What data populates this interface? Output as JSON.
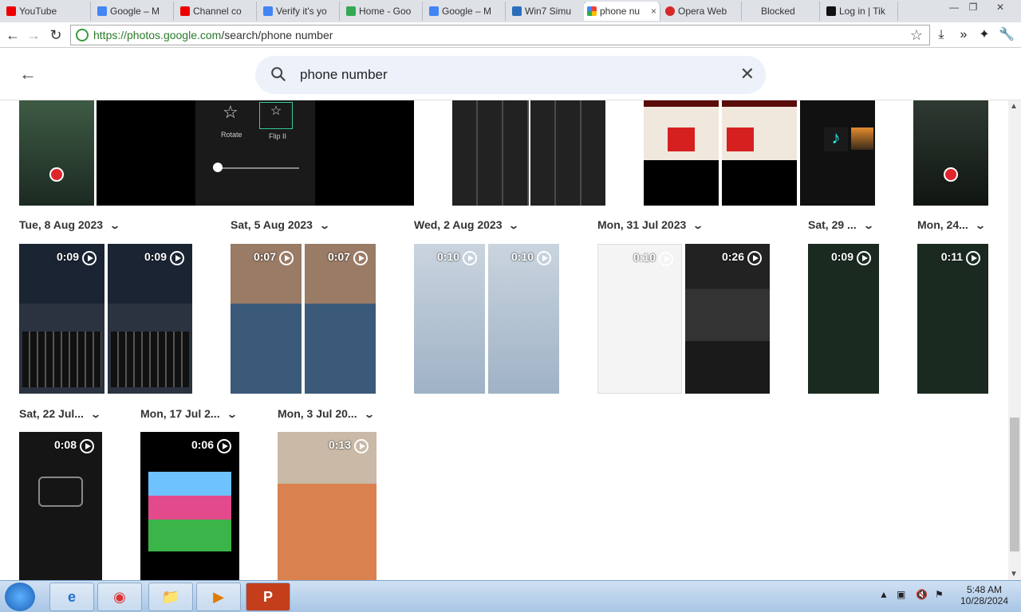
{
  "browser": {
    "tabs": [
      {
        "label": "YouTube",
        "color": "#e00"
      },
      {
        "label": "Google – M",
        "color": "#4285f4"
      },
      {
        "label": "Channel co",
        "color": "#e00"
      },
      {
        "label": "Verify it's yo",
        "color": "#4285f4"
      },
      {
        "label": "Home - Goo",
        "color": "#34a853"
      },
      {
        "label": "Google – M",
        "color": "#4285f4"
      },
      {
        "label": "Win7 Simu",
        "color": "#2a6ebb"
      },
      {
        "label": "phone nu",
        "color": "#fbbc05"
      },
      {
        "label": "Opera Web",
        "color": "#d62828"
      },
      {
        "label": "Blocked",
        "color": "#999"
      },
      {
        "label": "Log in | Tik",
        "color": "#111"
      }
    ],
    "active_tab_close": "×",
    "window_controls": {
      "minimize": "—",
      "maximize": "❐",
      "close": "✕"
    },
    "nav": {
      "back": "←",
      "forward": "→",
      "reload": "↻"
    },
    "url_host": "https://photos.google.com",
    "url_path": "/search/phone number",
    "bookmark_star": "☆",
    "right_tools": [
      "⤓",
      "»",
      "✦",
      "🔧"
    ]
  },
  "photos": {
    "back_icon": "←",
    "search_value": "phone number",
    "clear_icon": "✕",
    "groups_row1": [
      {
        "date": "Tue, 8 Aug 2023"
      },
      {
        "date": "Sat, 5 Aug 2023"
      },
      {
        "date": "Wed, 2 Aug 2023"
      },
      {
        "date": "Mon, 31 Jul 2023"
      },
      {
        "date": "Sat, 29 ..."
      },
      {
        "date": "Mon, 24..."
      }
    ],
    "groups_row2": [
      {
        "date": "Sat, 22 Jul..."
      },
      {
        "date": "Mon, 17 Jul 2..."
      },
      {
        "date": "Mon, 3 Jul 20..."
      }
    ],
    "videos": [
      {
        "duration": "0:09"
      },
      {
        "duration": "0:09"
      },
      {
        "duration": "0:07"
      },
      {
        "duration": "0:07"
      },
      {
        "duration": "0:10"
      },
      {
        "duration": "0:10"
      },
      {
        "duration": "0:10"
      },
      {
        "duration": "0:26"
      },
      {
        "duration": "0:09"
      },
      {
        "duration": "0:11"
      },
      {
        "duration": "0:08"
      },
      {
        "duration": "0:06"
      },
      {
        "duration": "0:13"
      }
    ],
    "top_strip_labels": {
      "rotate": "Rotate",
      "flip": "Flip II"
    }
  },
  "taskbar": {
    "apps": [
      "e",
      "◉",
      "📁",
      "▶",
      "P"
    ],
    "clock_time": "5:48 AM",
    "clock_date": "10/28/2024"
  }
}
